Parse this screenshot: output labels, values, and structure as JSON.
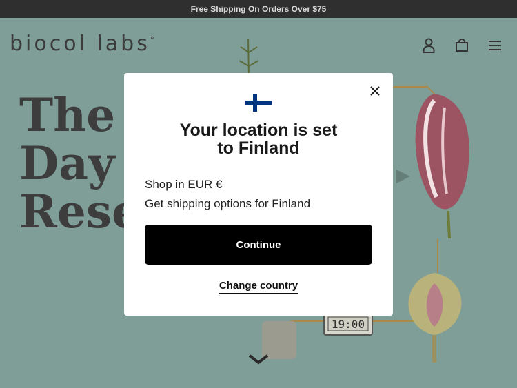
{
  "announcement": {
    "text": "Free Shipping On Orders Over $75"
  },
  "header": {
    "logo_text": "biocol labs",
    "logo_mark": "°",
    "icons": [
      "account-icon",
      "cart-icon",
      "menu-icon"
    ]
  },
  "hero": {
    "headline": "The 2\nDay F\nRese",
    "clock_text": "19:00"
  },
  "modal": {
    "title": "Your location is set\nto Finland",
    "currency_line": "Shop in EUR €",
    "shipping_line": "Get shipping options for Finland",
    "continue_label": "Continue",
    "change_label": "Change country",
    "flag": "finland-flag-icon"
  },
  "colors": {
    "hero_bg": "#7f9e98",
    "announce_bg": "#2f2f2f",
    "button_bg": "#000000"
  }
}
